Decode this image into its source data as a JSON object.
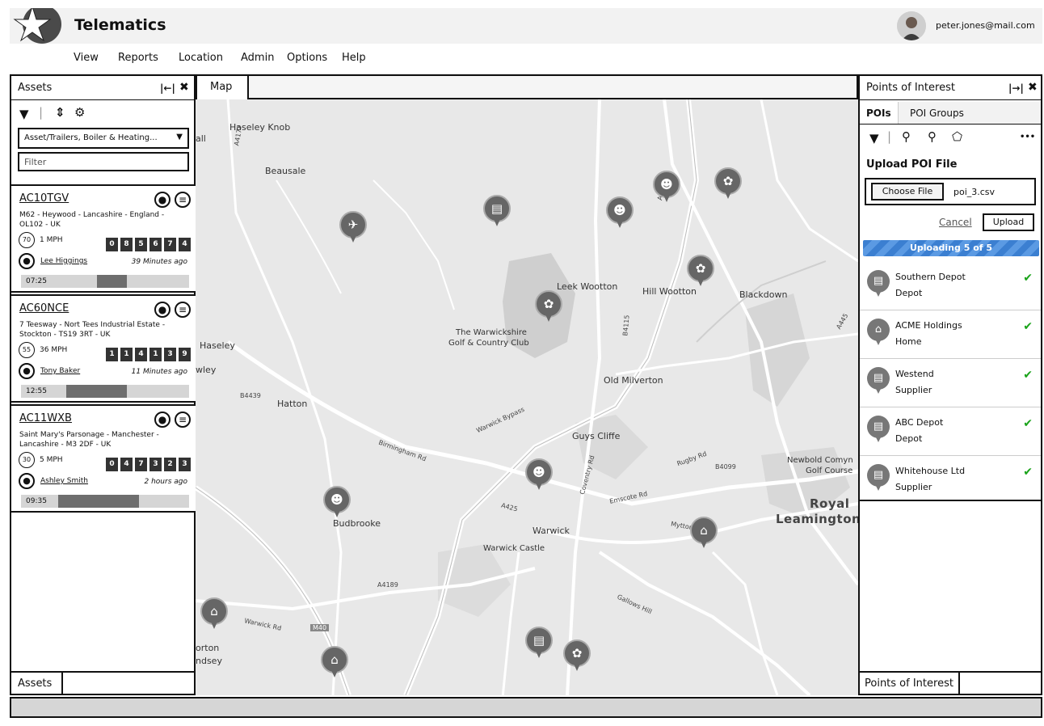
{
  "app": {
    "title": "Telematics"
  },
  "user": {
    "email": "peter.jones@mail.com"
  },
  "menu": [
    "View",
    "Reports",
    "Location",
    "Admin",
    "Options",
    "Help"
  ],
  "assets_panel": {
    "title": "Assets",
    "pin_label": "|←|",
    "close_label": "✖",
    "group_select": "Asset/Trailers, Boiler & Heating...",
    "filter_placeholder": "Filter",
    "bottom_tab": "Assets",
    "items": [
      {
        "reg": "AC10TGV",
        "address": "M62 - Heywood - Lancashire - England - OL102 - UK",
        "speed_limit": "70",
        "speed": "1 MPH",
        "odometer": [
          "0",
          "8",
          "5",
          "6",
          "7",
          "4"
        ],
        "driver": "Lee Higgings",
        "last_seen": "39 Minutes ago",
        "time": "07:25",
        "bar_start": 0.45,
        "bar_end": 0.63
      },
      {
        "reg": "AC60NCE",
        "address": "7 Teesway - Nort Tees Industrial Estate - Stockton - TS19 3RT - UK",
        "speed_limit": "55",
        "speed": "36 MPH",
        "odometer": [
          "1",
          "1",
          "4",
          "1",
          "3",
          "9"
        ],
        "driver": "Tony Baker",
        "last_seen": "11 Minutes ago",
        "time": "12:55",
        "bar_start": 0.27,
        "bar_end": 0.63
      },
      {
        "reg": "AC11WXB",
        "address": "Saint Mary's Parsonage - Manchester - Lancashire - M3 2DF - UK",
        "speed_limit": "30",
        "speed": "5 MPH",
        "odometer": [
          "0",
          "4",
          "7",
          "3",
          "2",
          "3"
        ],
        "driver": "Ashley Smith",
        "last_seen": "2 hours ago",
        "time": "09:35",
        "bar_start": 0.22,
        "bar_end": 0.7
      }
    ]
  },
  "map": {
    "tab": "Map",
    "places": [
      "Haseley Knob",
      "Beausale",
      "Leek Wootton",
      "Hill Wootton",
      "Blackdown",
      "The Warwickshire",
      "Golf & Country Club",
      "Haseley",
      "Hatton",
      "Old Milverton",
      "Guys Cliffe",
      "Budbrooke",
      "Warwick",
      "Warwick Castle",
      "Newbold Comyn",
      "Golf Course",
      "Royal",
      "Leamington",
      "orton",
      "ndsey",
      "all",
      "wley"
    ],
    "roads": [
      "A4177",
      "Warwick Bypass",
      "Birmingham Rd",
      "B4439",
      "A425",
      "A4189",
      "M40",
      "A452",
      "B4115",
      "Emscote Rd",
      "Rugby Rd",
      "B4099",
      "Mytton Rd",
      "A445",
      "Coventry Rd",
      "Warwick Rd",
      "Gallows Hill"
    ]
  },
  "poi_panel": {
    "title": "Points of Interest",
    "pin_label": "|→|",
    "close_label": "✖",
    "tabs": [
      "POIs",
      "POI Groups"
    ],
    "more_label": "•••",
    "upload_title": "Upload POI File",
    "choose_file": "Choose File",
    "file_name": "poi_3.csv",
    "cancel": "Cancel",
    "upload": "Upload",
    "progress": "Uploading 5 of 5",
    "bottom_tab": "Points of Interest",
    "items": [
      {
        "name": "Southern Depot",
        "type": "Depot",
        "icon": "depot-icon"
      },
      {
        "name": "ACME Holdings",
        "type": "Home",
        "icon": "home-icon"
      },
      {
        "name": "Westend",
        "type": "Supplier",
        "icon": "supplier-icon"
      },
      {
        "name": "ABC Depot",
        "type": "Depot",
        "icon": "depot-icon"
      },
      {
        "name": "Whitehouse Ltd",
        "type": "Supplier",
        "icon": "supplier-icon"
      }
    ]
  },
  "colors": {
    "progress": "#3b7fd1",
    "check": "#1aa31a",
    "pin": "#666666",
    "map_bg": "#e6e6e6"
  }
}
